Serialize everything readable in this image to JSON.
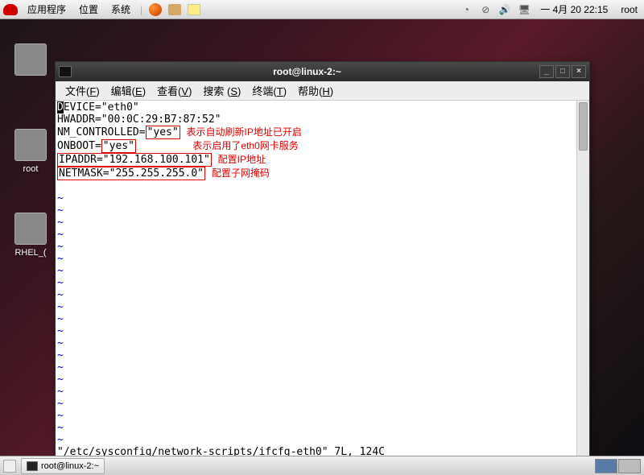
{
  "panel": {
    "apps": "应用程序",
    "places": "位置",
    "system": "系统",
    "datetime": "一  4月 20 22:15",
    "user": "root"
  },
  "desktop": {
    "icon1": "root",
    "icon2": "RHEL_(",
    "computer_folder": ""
  },
  "window": {
    "title": "root@linux-2:~",
    "menus": {
      "file": "文件",
      "file_u": "F",
      "edit": "编辑",
      "edit_u": "E",
      "view": "查看",
      "view_u": "V",
      "search": "搜索 ",
      "search_u": "S",
      "terminal": "终端",
      "terminal_u": "T",
      "help": "帮助",
      "help_u": "H"
    }
  },
  "content": {
    "l1a": "D",
    "l1b": "EVICE=\"eth0\"",
    "l2": "HWADDR=\"00:0C:29:B7:87:52\"",
    "l3a": "NM_CONTROLLED=",
    "l3box": "\"yes\"",
    "l3note": "表示自动刷新IP地址已开启",
    "l4a": "ONBOOT=",
    "l4box": "\"yes\"",
    "l4note": "表示启用了eth0网卡服务",
    "l5a": "IPADDR=\"192.168.100.101\"",
    "l5note": "配置IP地址",
    "l6a": "NETMASK=\"255.255.255.0\"",
    "l6note": "配置子网掩码",
    "tilde": "~",
    "status": "\"/etc/sysconfig/network-scripts/ifcfg-eth0\" 7L, 124C"
  },
  "taskbar": {
    "task": "root@linux-2:~"
  }
}
